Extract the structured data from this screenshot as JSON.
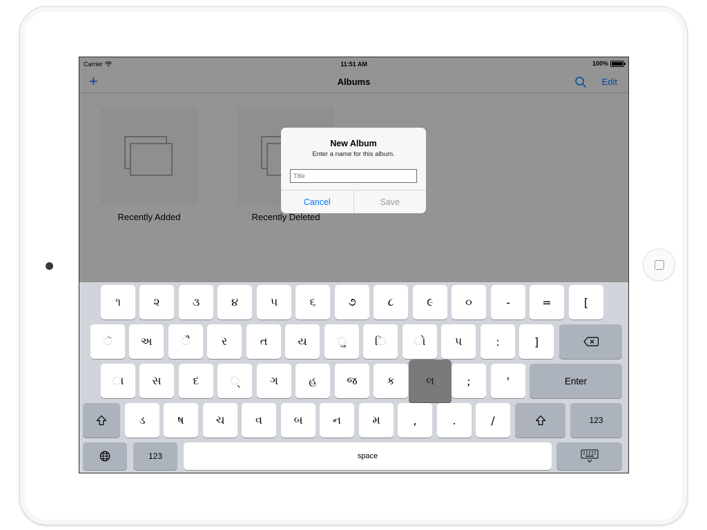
{
  "status_bar": {
    "carrier": "Carrier",
    "time": "11:51 AM",
    "battery": "100%"
  },
  "nav": {
    "add": "+",
    "title": "Albums",
    "edit": "Edit"
  },
  "albums": [
    {
      "label": "Recently Added"
    },
    {
      "label": "Recently Deleted"
    }
  ],
  "alert": {
    "title": "New Album",
    "message": "Enter a name for this album.",
    "placeholder": "Title",
    "cancel": "Cancel",
    "save": "Save"
  },
  "keyboard": {
    "row1": [
      "૧",
      "૨",
      "૩",
      "૪",
      "૫",
      "૬",
      "૭",
      "૮",
      "૯",
      "૦",
      "-",
      "=",
      "["
    ],
    "row2": [
      "ૅ",
      "અ",
      "ૈ",
      "ર",
      "ત",
      "ય",
      "ુ",
      "િ",
      "ો",
      "પ",
      ":",
      "]"
    ],
    "row3": [
      "ા",
      "સ",
      "દ",
      "્",
      "ગ",
      "હ",
      "જ",
      "ક",
      "લ",
      ";",
      "'"
    ],
    "row4": [
      "ડ",
      "ષ",
      "ચ",
      "વ",
      "બ",
      "ન",
      "મ",
      ",",
      ".",
      "/"
    ],
    "enter": "Enter",
    "numbers_label": "123",
    "space": "space",
    "pressed_key": "લ"
  }
}
